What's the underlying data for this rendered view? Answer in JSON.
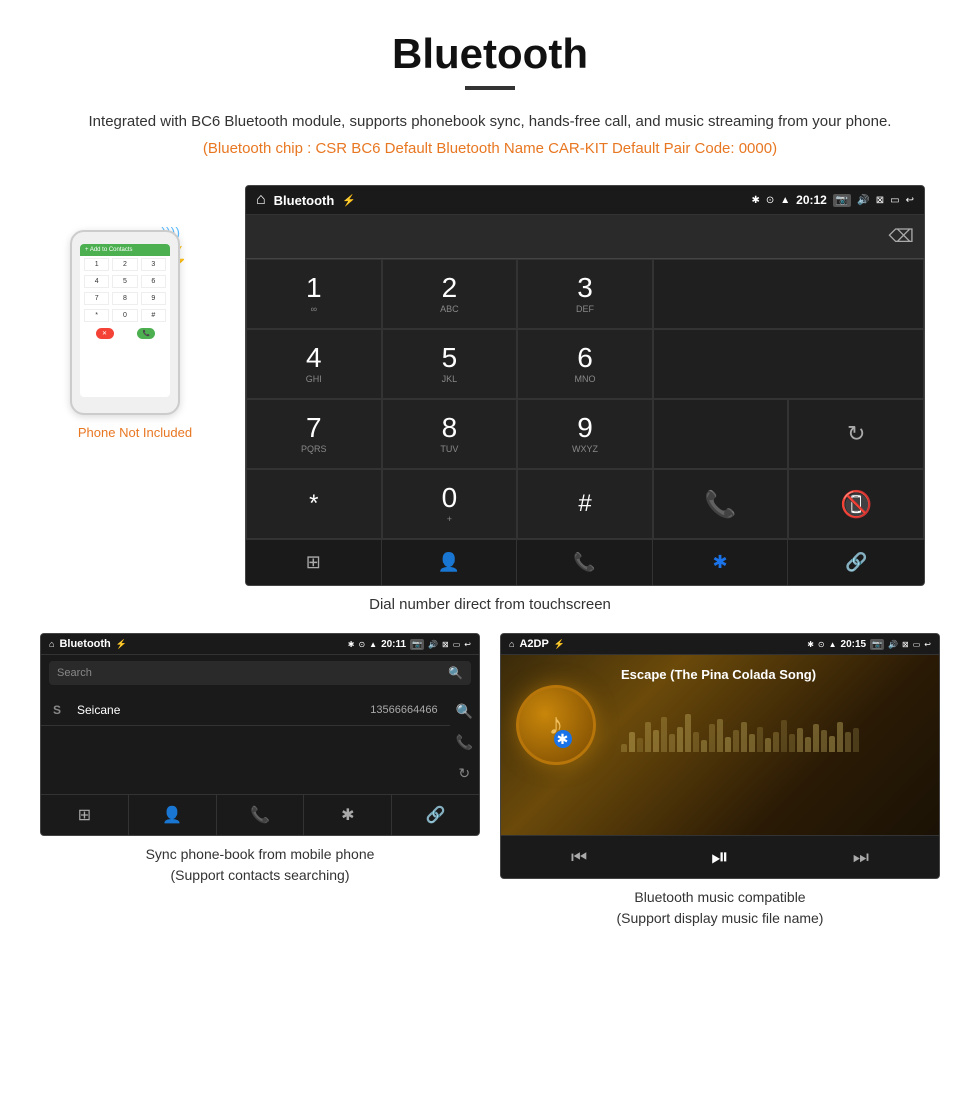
{
  "page": {
    "title": "Bluetooth",
    "description": "Integrated with BC6 Bluetooth module, supports phonebook sync, hands-free call, and music streaming from your phone.",
    "orange_info": "(Bluetooth chip : CSR BC6    Default Bluetooth Name CAR-KIT    Default Pair Code: 0000)",
    "dial_caption": "Dial number direct from touchscreen"
  },
  "dialer": {
    "status_title": "Bluetooth",
    "time": "20:12",
    "keys": [
      {
        "digit": "1",
        "letters": "∞"
      },
      {
        "digit": "2",
        "letters": "ABC"
      },
      {
        "digit": "3",
        "letters": "DEF"
      },
      {
        "digit": "",
        "letters": ""
      },
      {
        "digit": "",
        "letters": ""
      },
      {
        "digit": "4",
        "letters": "GHI"
      },
      {
        "digit": "5",
        "letters": "JKL"
      },
      {
        "digit": "6",
        "letters": "MNO"
      },
      {
        "digit": "",
        "letters": ""
      },
      {
        "digit": "",
        "letters": ""
      },
      {
        "digit": "7",
        "letters": "PQRS"
      },
      {
        "digit": "8",
        "letters": "TUV"
      },
      {
        "digit": "9",
        "letters": "WXYZ"
      },
      {
        "digit": "",
        "letters": ""
      },
      {
        "digit": "",
        "letters": ""
      },
      {
        "digit": "*",
        "letters": ""
      },
      {
        "digit": "0",
        "letters": "+"
      },
      {
        "digit": "#",
        "letters": ""
      },
      {
        "digit": "call",
        "letters": ""
      },
      {
        "digit": "end",
        "letters": ""
      }
    ],
    "bottom_icons": [
      "grid",
      "person",
      "phone",
      "bluetooth",
      "link"
    ]
  },
  "phonebook": {
    "status_title": "Bluetooth",
    "time": "20:11",
    "search_placeholder": "Search",
    "contact_letter": "S",
    "contact_name": "Seicane",
    "contact_number": "13566664466",
    "bottom_icons": [
      "grid",
      "person",
      "phone",
      "bluetooth",
      "link"
    ],
    "caption_line1": "Sync phone-book from mobile phone",
    "caption_line2": "(Support contacts searching)"
  },
  "music": {
    "status_title": "A2DP",
    "time": "20:15",
    "song_title": "Escape (The Pina Colada Song)",
    "caption_line1": "Bluetooth music compatible",
    "caption_line2": "(Support display music file name)"
  },
  "phone": {
    "not_included": "Phone Not Included"
  },
  "icons": {
    "home": "⌂",
    "usb": "⚡",
    "bluetooth": "✱",
    "location": "◉",
    "wifi": "▲",
    "camera": "📷",
    "volume": "🔊",
    "close_box": "⊠",
    "screen": "▭",
    "back": "↩",
    "grid": "⊞",
    "person": "👤",
    "phone_icon": "📞",
    "bt_icon": "✱",
    "link": "🔗",
    "search": "🔍",
    "call_end": "📵",
    "prev": "⏮",
    "play_pause": "⏯",
    "next": "⏭"
  },
  "eq_bars": [
    8,
    20,
    14,
    30,
    22,
    35,
    18,
    25,
    38,
    20,
    12,
    28,
    33,
    15,
    22,
    30,
    18,
    25,
    14,
    20,
    32,
    18,
    24,
    15,
    28,
    22,
    16,
    30,
    20,
    24
  ]
}
